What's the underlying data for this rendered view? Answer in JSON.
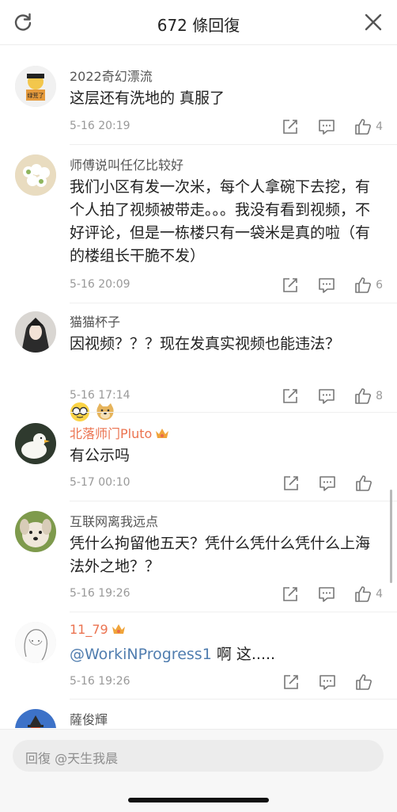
{
  "header": {
    "title": "672 條回復"
  },
  "comments": [
    {
      "name": "2022奇幻漂流",
      "content": "这层还有洗地的 真服了",
      "date": "5-16 20:19",
      "likes": "4",
      "avatar_text": "绿荒了"
    },
    {
      "name": "师傅说叫任亿比较好",
      "content": "我们小区有发一次米，每个人拿碗下去挖，有个人拍了视频被带走。。。我没有看到视频，不好评论，但是一栋楼只有一袋米是真的啦（有的楼组长干脆不发）",
      "date": "5-16 20:09",
      "likes": "6"
    },
    {
      "name": "猫猫杯子",
      "content": "因视频？？？现在发真实视频也能违法？",
      "emojis": [
        "glasses-emoji",
        "doge-emoji"
      ],
      "date": "5-16 17:14",
      "likes": "8"
    },
    {
      "name": "北落师门Pluto",
      "vip": true,
      "content": "有公示吗",
      "date": "5-17 00:10",
      "likes": ""
    },
    {
      "name": "互联网离我远点",
      "content": "凭什么拘留他五天？凭什么凭什么凭什么上海法外之地？？",
      "date": "5-16 19:26",
      "likes": "4"
    },
    {
      "name": "11_79",
      "vip": true,
      "mention": "@WorkiNProgress1",
      "content": " 啊 这.....",
      "date": "5-16 19:26",
      "likes": ""
    },
    {
      "name": "薩俊輝"
    }
  ],
  "footer": {
    "placeholder": "回復 @天生我晨"
  },
  "colors": {
    "vip_name": "#eb7350",
    "mention": "#507daf",
    "meta": "#999999"
  }
}
